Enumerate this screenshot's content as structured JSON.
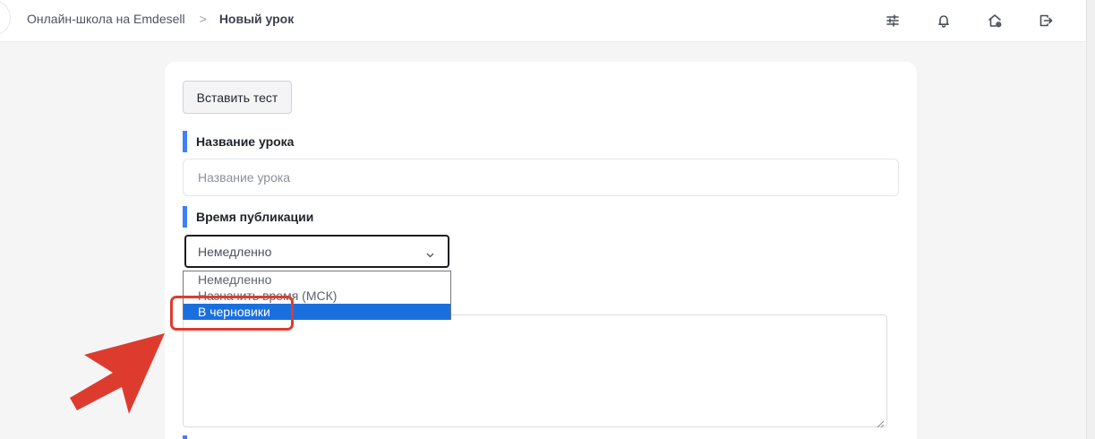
{
  "breadcrumb": {
    "school": "Онлайн-школа на Emdesell",
    "separator": ">",
    "current": "Новый урок"
  },
  "topbar_icons": [
    "sliders-icon",
    "bell-icon",
    "home-settings-icon",
    "logout-icon"
  ],
  "form": {
    "insert_test_button": "Вставить тест",
    "lesson_title_label": "Название урока",
    "lesson_title_placeholder": "Название урока",
    "lesson_title_value": "",
    "publish_time_label": "Время публикации",
    "publish_time_selected": "Немедленно",
    "publish_time_options": [
      "Немедленно",
      "Назначить время (МСК)",
      "В черновики"
    ],
    "highlighted_option": "В черновики"
  },
  "colors": {
    "accent": "#3b82f6",
    "dropdown_selection": "#1a6fde",
    "annotation": "#de3b2f"
  }
}
